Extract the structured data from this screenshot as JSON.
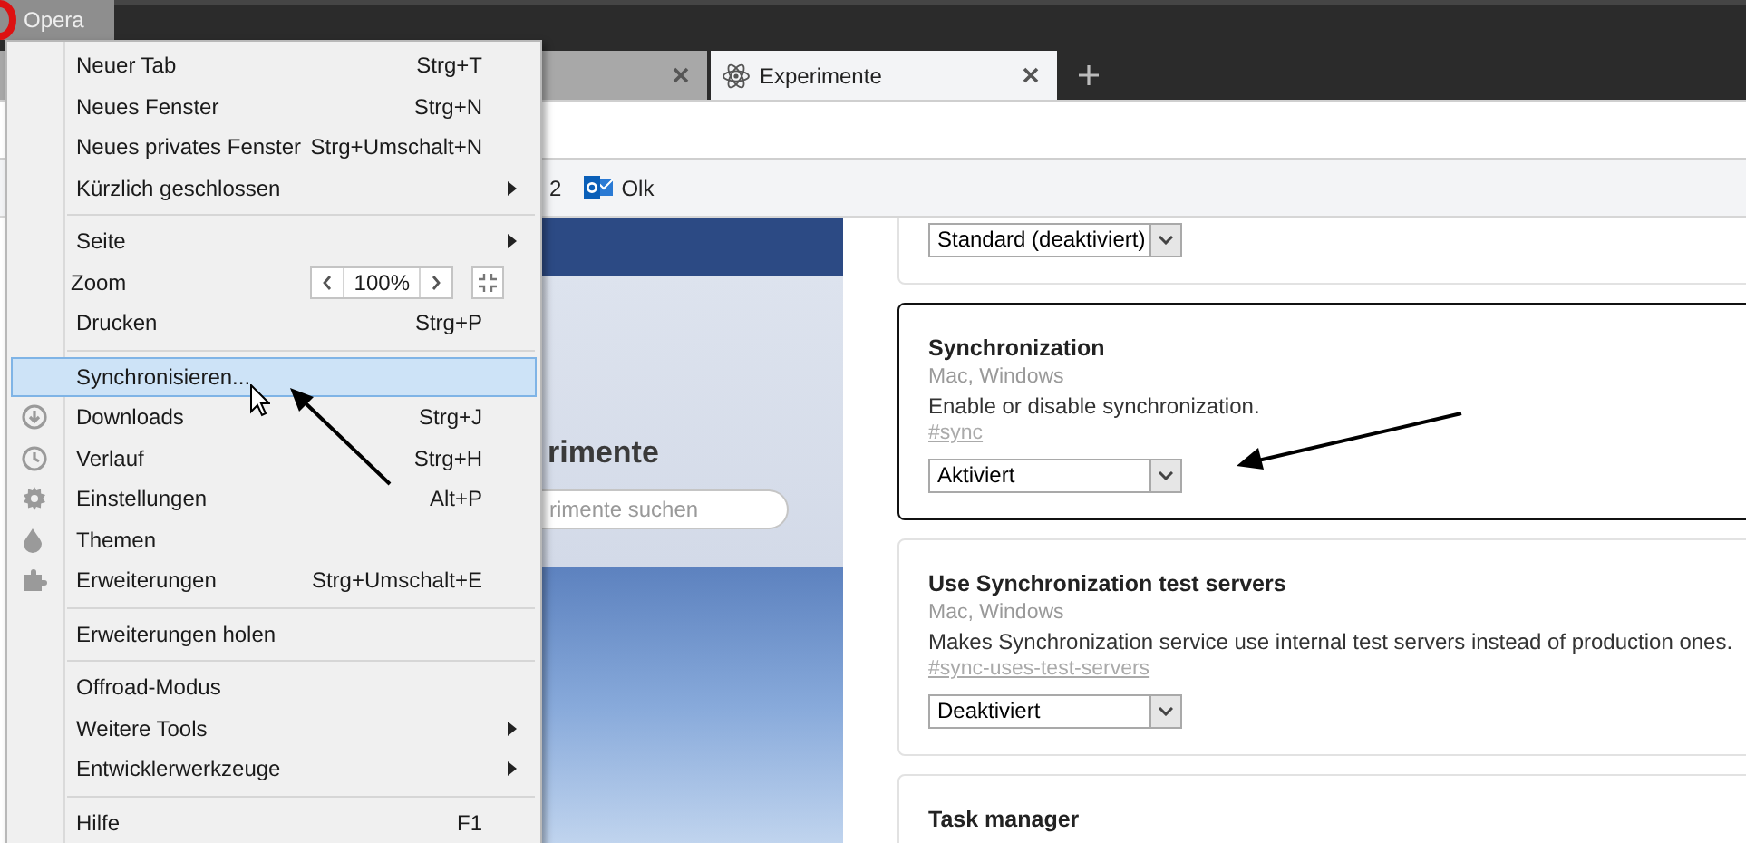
{
  "opera_button": {
    "label": "Opera"
  },
  "tabs": [
    {
      "selected": false
    },
    {
      "title": "Experimente",
      "selected": true
    }
  ],
  "bookmarks": [
    {
      "label": "2",
      "kind": "text"
    },
    {
      "label": "Olk",
      "kind": "outlook"
    }
  ],
  "sidebar": {
    "heading": "rimente",
    "search_placeholder": "rimente suchen"
  },
  "experiments": [
    {
      "value": "Standard (deaktiviert)",
      "focused": false
    },
    {
      "title": "Synchronization",
      "platforms": "Mac, Windows",
      "description": "Enable or disable synchronization.",
      "link": "#sync",
      "value": "Aktiviert",
      "focused": true
    },
    {
      "title": "Use Synchronization test servers",
      "platforms": "Mac, Windows",
      "description": "Makes Synchronization service use internal test servers instead of production ones.",
      "link": "#sync-uses-test-servers",
      "value": "Deaktiviert",
      "focused": false
    },
    {
      "title": "Task manager",
      "focused": false
    }
  ],
  "menu": {
    "items": [
      {
        "kind": "item",
        "label": "Neuer Tab",
        "shortcut": "Strg+T",
        "submenu": false,
        "selected": false
      },
      {
        "kind": "item",
        "label": "Neues Fenster",
        "shortcut": "Strg+N",
        "submenu": false,
        "selected": false
      },
      {
        "kind": "item",
        "label": "Neues privates Fenster",
        "shortcut": "Strg+Umschalt+N",
        "submenu": false,
        "selected": false
      },
      {
        "kind": "item",
        "label": "Kürzlich geschlossen",
        "submenu": true,
        "selected": false
      },
      {
        "kind": "separator"
      },
      {
        "kind": "item",
        "label": "Seite",
        "submenu": true,
        "selected": false
      },
      {
        "kind": "zoom",
        "label": "Zoom",
        "value": "100%"
      },
      {
        "kind": "item",
        "label": "Drucken",
        "shortcut": "Strg+P",
        "submenu": false,
        "selected": false
      },
      {
        "kind": "separator"
      },
      {
        "kind": "item",
        "label": "Synchronisieren...",
        "submenu": false,
        "selected": true
      },
      {
        "kind": "item",
        "label": "Downloads",
        "shortcut": "Strg+J",
        "submenu": false,
        "selected": false
      },
      {
        "kind": "item",
        "label": "Verlauf",
        "shortcut": "Strg+H",
        "submenu": false,
        "selected": false
      },
      {
        "kind": "item",
        "label": "Einstellungen",
        "shortcut": "Alt+P",
        "submenu": false,
        "selected": false
      },
      {
        "kind": "item",
        "label": "Themen",
        "submenu": false,
        "selected": false
      },
      {
        "kind": "item",
        "label": "Erweiterungen",
        "shortcut": "Strg+Umschalt+E",
        "submenu": false,
        "selected": false
      },
      {
        "kind": "separator"
      },
      {
        "kind": "item",
        "label": "Erweiterungen holen",
        "submenu": false,
        "selected": false
      },
      {
        "kind": "separator"
      },
      {
        "kind": "item",
        "label": "Offroad-Modus",
        "submenu": false,
        "selected": false
      },
      {
        "kind": "item",
        "label": "Weitere Tools",
        "submenu": true,
        "selected": false
      },
      {
        "kind": "item",
        "label": "Entwicklerwerkzeuge",
        "submenu": true,
        "selected": false
      },
      {
        "kind": "separator"
      },
      {
        "kind": "item",
        "label": "Hilfe",
        "shortcut": "F1",
        "submenu": false,
        "selected": false
      }
    ]
  }
}
